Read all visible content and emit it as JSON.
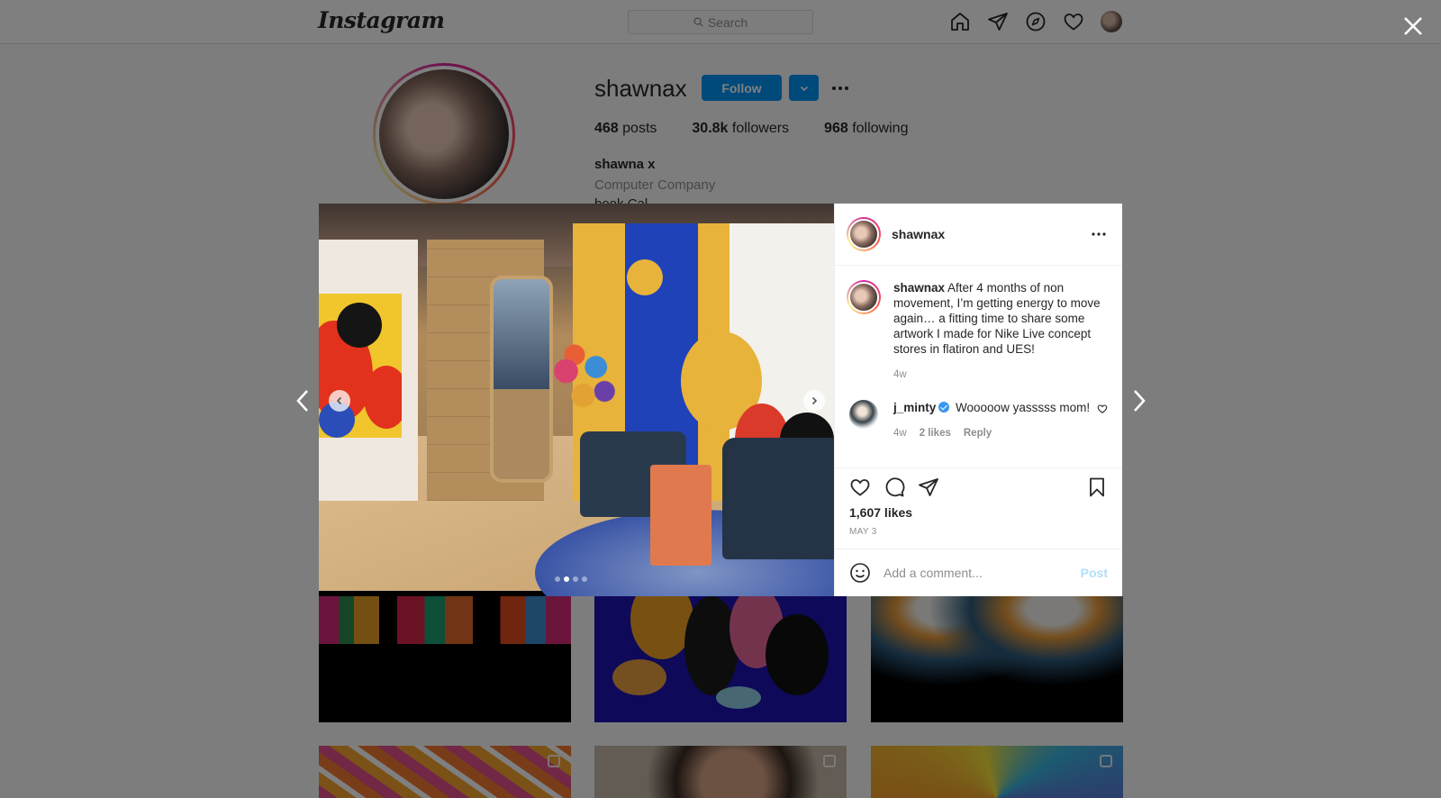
{
  "app": {
    "logo": "Instagram"
  },
  "topbar": {
    "search_placeholder": "Search"
  },
  "profile": {
    "username": "shawnax",
    "follow_label": "Follow",
    "stats": [
      {
        "count": "468",
        "label": "posts"
      },
      {
        "count": "30.8k",
        "label": "followers"
      },
      {
        "count": "968",
        "label": "following"
      }
    ],
    "full_name": "shawna x",
    "category": "Computer Company",
    "bio_partial": "book Cal"
  },
  "post": {
    "author": "shawnax",
    "caption": {
      "username": "shawnax",
      "text": "After 4 months of non movement, I’m getting energy to move again… a fitting time to share some artwork I made for Nike Live concept stores in flatiron and UES!",
      "time": "4w"
    },
    "comments": [
      {
        "username": "j_minty",
        "verified": true,
        "text": "Wooooow yasssss mom!",
        "time": "4w",
        "likes": "2 likes",
        "reply_label": "Reply"
      }
    ],
    "likes": "1,607 likes",
    "date": "MAY 3",
    "carousel": {
      "count": 4,
      "active_index": 1
    },
    "add_comment_placeholder": "Add a comment...",
    "post_button": "Post"
  },
  "icons": {
    "search": "search-icon",
    "home": "home-icon",
    "direct": "paper-plane-icon",
    "explore": "compass-icon",
    "activity": "heart-icon",
    "close": "close-icon",
    "more": "more-icon",
    "comment": "comment-icon",
    "bookmark": "bookmark-icon",
    "emoji": "emoji-icon"
  },
  "colors": {
    "accent": "#0095f6",
    "verified": "#3897f0",
    "post_button_disabled": "#b2dffc",
    "overlay": "rgba(0,0,0,0.5)"
  }
}
